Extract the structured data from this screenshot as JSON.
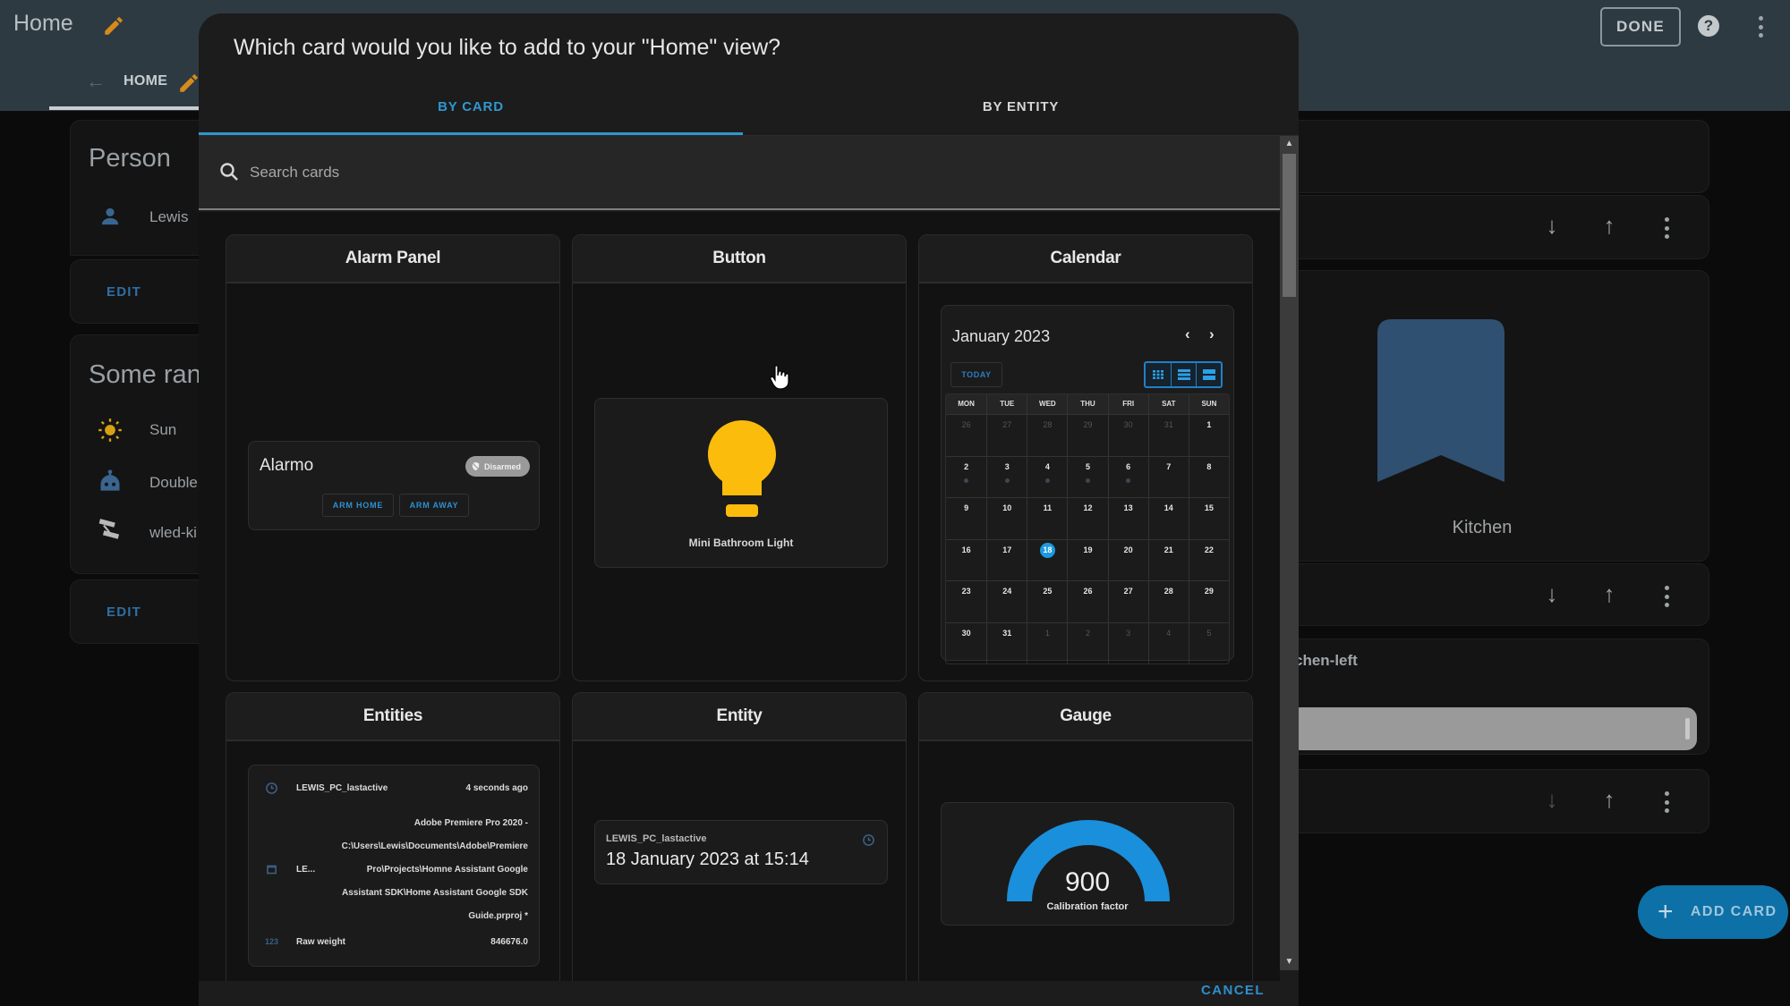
{
  "app": {
    "title": "Home",
    "view_tab": "HOME",
    "done_label": "DONE",
    "add_card_label": "ADD CARD",
    "colors": {
      "header": "#2e3a42",
      "accent": "#2f97d0",
      "fab": "#0d70a6"
    }
  },
  "background": {
    "person_card": {
      "title": "Person",
      "rows": [
        {
          "icon": "account-icon",
          "label": "Lewis"
        }
      ],
      "edit_label": "EDIT"
    },
    "entities_card": {
      "title": "Some ran",
      "rows": [
        {
          "icon": "sun-icon",
          "label": "Sun"
        },
        {
          "icon": "robot-icon",
          "label": "Double"
        },
        {
          "icon": "led-strip-icon",
          "label": "wled-ki"
        }
      ],
      "edit_label": "EDIT"
    },
    "area_card": {
      "label": "Kitchen",
      "icon": "bookmark-icon"
    },
    "light_card": {
      "label": "chen-left"
    }
  },
  "dialog": {
    "title": "Which card would you like to add to your \"Home\" view?",
    "tabs": [
      {
        "label": "BY CARD",
        "active": true
      },
      {
        "label": "BY ENTITY",
        "active": false
      }
    ],
    "search": {
      "placeholder": "Search cards",
      "value": ""
    },
    "cancel_label": "CANCEL",
    "cards": [
      {
        "title": "Alarm Panel",
        "preview": {
          "name": "Alarmo",
          "state": "Disarmed",
          "buttons": [
            "ARM HOME",
            "ARM AWAY"
          ]
        }
      },
      {
        "title": "Button",
        "preview": {
          "name": "Mini Bathroom Light",
          "icon": "lightbulb-icon",
          "icon_color": "#fbbc0b"
        }
      },
      {
        "title": "Calendar",
        "preview": {
          "month": "January 2023",
          "today_label": "TODAY",
          "weekdays": [
            "MON",
            "TUE",
            "WED",
            "THU",
            "FRI",
            "SAT",
            "SUN"
          ],
          "weeks": [
            [
              "26",
              "27",
              "28",
              "29",
              "30",
              "31",
              "1"
            ],
            [
              "2",
              "3",
              "4",
              "5",
              "6",
              "7",
              "8"
            ],
            [
              "9",
              "10",
              "11",
              "12",
              "13",
              "14",
              "15"
            ],
            [
              "16",
              "17",
              "18",
              "19",
              "20",
              "21",
              "22"
            ],
            [
              "23",
              "24",
              "25",
              "26",
              "27",
              "28",
              "29"
            ],
            [
              "30",
              "31",
              "1",
              "2",
              "3",
              "4",
              "5"
            ]
          ],
          "today": "18",
          "event_days": [
            "2",
            "3",
            "4",
            "5",
            "6"
          ]
        }
      },
      {
        "title": "Entities",
        "preview": {
          "rows": [
            {
              "icon": "clock-icon",
              "name": "LEWIS_PC_lastactive",
              "value": "4 seconds ago"
            },
            {
              "icon": "window-icon",
              "name": "LE...",
              "value_lines": [
                "Adobe Premiere Pro 2020 -",
                "C:\\Users\\Lewis\\Documents\\Adobe\\Premiere",
                "Pro\\Projects\\Homne Assistant Google",
                "Assistant SDK\\Home Assistant Google SDK",
                "Guide.prproj *"
              ]
            },
            {
              "icon": "numeric-icon",
              "icon_text": "123",
              "name": "Raw weight",
              "value": "846676.0"
            }
          ]
        }
      },
      {
        "title": "Entity",
        "preview": {
          "name": "LEWIS_PC_lastactive",
          "value": "18 January 2023 at 15:14",
          "icon": "clock-icon"
        }
      },
      {
        "title": "Gauge",
        "preview": {
          "value": "900",
          "label": "Calibration factor",
          "fraction": 1.0,
          "color": "#1a8fdc"
        }
      }
    ]
  }
}
